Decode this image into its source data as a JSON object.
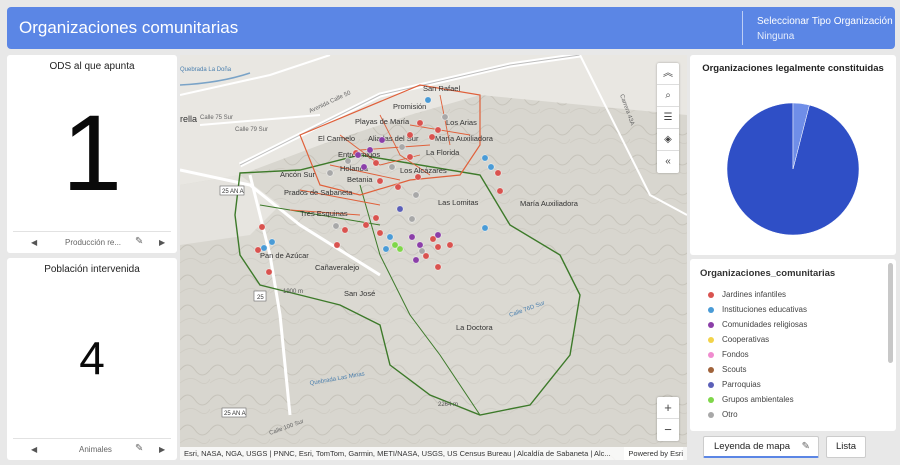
{
  "header": {
    "title": "Organizaciones comunitarias",
    "selector_label": "Seleccionar Tipo Organización",
    "selector_value": "Ninguna"
  },
  "card1": {
    "title": "ODS al que apunta",
    "value": "1",
    "footer_label": "Producción re..."
  },
  "card2": {
    "title": "Población intervenida",
    "value": "4",
    "footer_label": "Animales"
  },
  "map": {
    "labels": [
      {
        "text": "San Rafael"
      },
      {
        "text": "Promisión"
      },
      {
        "text": "Playas de María"
      },
      {
        "text": "Los Arias"
      },
      {
        "text": "María Auxiliadora"
      },
      {
        "text": "El Carmelo"
      },
      {
        "text": "Aliadas del Sur"
      },
      {
        "text": "La Florida"
      },
      {
        "text": "Entreamigos"
      },
      {
        "text": "Holanda"
      },
      {
        "text": "Los Alcázares"
      },
      {
        "text": "Betania"
      },
      {
        "text": "Ancón Sur"
      },
      {
        "text": "Prados de Sabaneta"
      },
      {
        "text": "Las Lomitas"
      },
      {
        "text": "María Auxiliadora"
      },
      {
        "text": "Tres Esquinas"
      },
      {
        "text": "Pan de Azúcar"
      },
      {
        "text": "Cañaveralejo"
      },
      {
        "text": "San José"
      },
      {
        "text": "La Doctora"
      },
      {
        "text": "rella"
      },
      {
        "text": "Quebrada La Doña"
      },
      {
        "text": "Calle 75 Sur"
      },
      {
        "text": "Calle 79 Sur"
      },
      {
        "text": "Avenida Calle 50"
      },
      {
        "text": "25 AN A"
      },
      {
        "text": "25"
      },
      {
        "text": "25 AN A"
      },
      {
        "text": "1900 m"
      },
      {
        "text": "2264 m"
      },
      {
        "text": "Carrera 43A"
      },
      {
        "text": "Quebrada Las Minas"
      },
      {
        "text": "Calle 76D Sur"
      },
      {
        "text": "Calle 100 Sur"
      }
    ],
    "attribution": "Esri, NASA, NGA, USGS | PNNC, Esri, TomTom, Garmin, METI/NASA, USGS, US Census Bureau | Alcaldía de Sabaneta | Alc...",
    "powered_by": "Powered by Esri",
    "tool_icons": [
      "collapse-icon",
      "search-icon",
      "legend-icon",
      "layers-icon",
      "chevron-left-icon"
    ]
  },
  "pie": {
    "title": "Organizaciones legalmente constituidas",
    "chart_data": {
      "type": "pie",
      "slices": [
        {
          "value": 96,
          "color": "#2f4fc6"
        },
        {
          "value": 4,
          "color": "#6f8ee8"
        }
      ]
    }
  },
  "legend": {
    "title": "Organizaciones_comunitarias",
    "items": [
      {
        "label": "Jardines infantiles",
        "color": "#d9534f"
      },
      {
        "label": "Instituciones educativas",
        "color": "#4a9bd6"
      },
      {
        "label": "Comunidades religiosas",
        "color": "#8b3fa8"
      },
      {
        "label": "Cooperativas",
        "color": "#f2d34a"
      },
      {
        "label": "Fondos",
        "color": "#f08ccf"
      },
      {
        "label": "Scouts",
        "color": "#a0633b"
      },
      {
        "label": "Parroquias",
        "color": "#5b5fb8"
      },
      {
        "label": "Grupos ambientales",
        "color": "#7fd64a"
      },
      {
        "label": "Otro",
        "color": "#a8a8a8"
      }
    ]
  },
  "buttons": {
    "leyenda": "Leyenda de mapa",
    "lista": "Lista"
  },
  "colors": {
    "header": "#5b86e5",
    "boundary_orange": "#e0603a",
    "boundary_green": "#3d7a2a"
  }
}
